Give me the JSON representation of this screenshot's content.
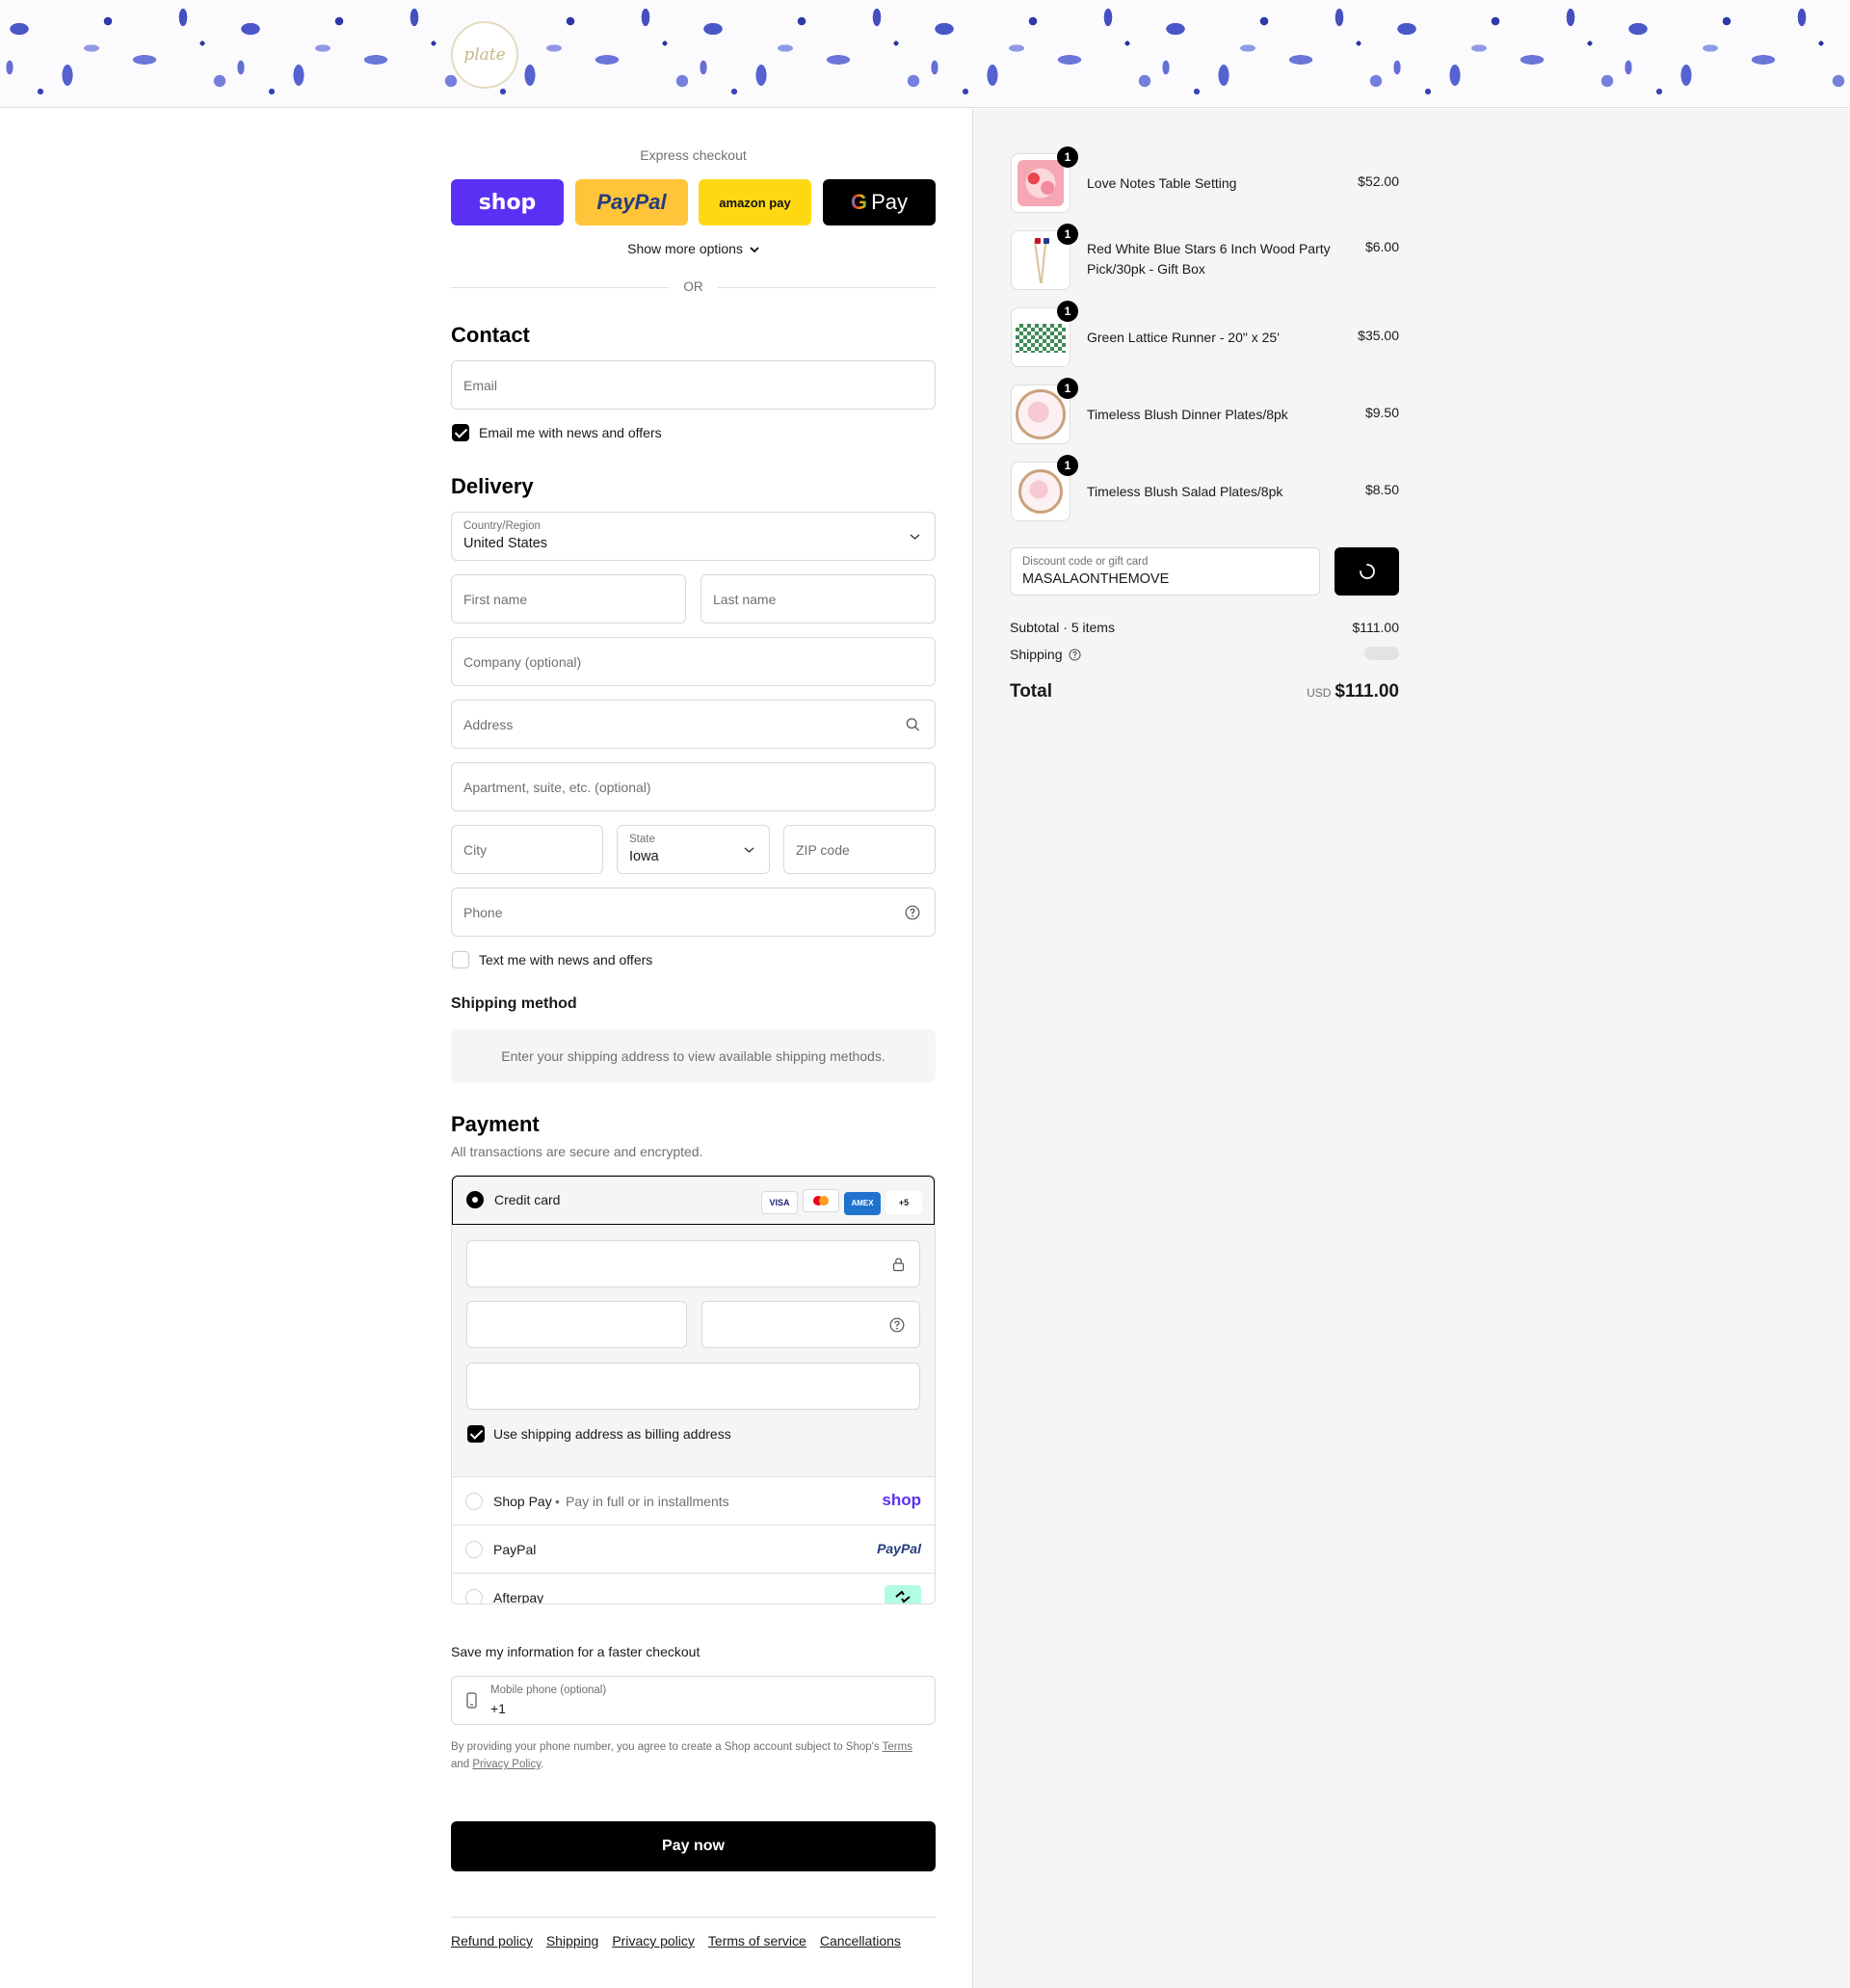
{
  "header": {
    "logo_text": "plate"
  },
  "express": {
    "title": "Express checkout",
    "buttons": [
      "shop",
      "PayPal",
      "amazon pay",
      "Pay"
    ],
    "colors": {
      "shop": "#5a31f4",
      "paypal": "#ffc439",
      "amazon": "#ffd814",
      "gpay": "#000000"
    },
    "more": "Show more options",
    "or": "OR"
  },
  "contact": {
    "heading": "Contact",
    "email_placeholder": "Email",
    "news_label": "Email me with news and offers",
    "news_checked": true
  },
  "delivery": {
    "heading": "Delivery",
    "country_label": "Country/Region",
    "country_value": "United States",
    "first_name": "First name",
    "last_name": "Last name",
    "company": "Company (optional)",
    "address": "Address",
    "apartment": "Apartment, suite, etc. (optional)",
    "city": "City",
    "state_label": "State",
    "state_value": "Iowa",
    "zip": "ZIP code",
    "phone": "Phone",
    "text_label": "Text me with news and offers",
    "text_checked": false
  },
  "shipping_method": {
    "heading": "Shipping method",
    "message": "Enter your shipping address to view available shipping methods."
  },
  "payment": {
    "heading": "Payment",
    "subtitle": "All transactions are secure and encrypted.",
    "credit_card": "Credit card",
    "card_brands": [
      "VISA",
      "MC",
      "AMEX",
      "+5"
    ],
    "billing_label": "Use shipping address as billing address",
    "billing_checked": true,
    "shop_pay": "Shop Pay",
    "shop_pay_sub": "Pay in full or in installments",
    "shop_logo": "shop",
    "paypal": "PayPal",
    "paypal_logo": "PayPal",
    "afterpay": "Afterpay"
  },
  "save": {
    "title": "Save my information for a faster checkout",
    "mobile_label": "Mobile phone (optional)",
    "mobile_value": "+1",
    "disclaimer_prefix": "By providing your phone number, you agree to create a Shop account subject to Shop's",
    "terms": "Terms",
    "and": "and",
    "privacy": "Privacy Policy"
  },
  "pay_button": "Pay now",
  "footer": [
    "Refund policy",
    "Shipping",
    "Privacy policy",
    "Terms of service",
    "Cancellations"
  ],
  "cart": {
    "items": [
      {
        "name": "Love Notes Table Setting",
        "price": "$52.00",
        "qty": "1"
      },
      {
        "name": "Red White Blue Stars 6 Inch Wood Party Pick/30pk - Gift Box",
        "price": "$6.00",
        "qty": "1"
      },
      {
        "name": "Green Lattice Runner - 20\" x 25'",
        "price": "$35.00",
        "qty": "1"
      },
      {
        "name": "Timeless Blush Dinner Plates/8pk",
        "price": "$9.50",
        "qty": "1"
      },
      {
        "name": "Timeless Blush Salad Plates/8pk",
        "price": "$8.50",
        "qty": "1"
      }
    ],
    "discount_label": "Discount code or gift card",
    "discount_value": "MASALAONTHEMOVE",
    "subtotal_label": "Subtotal · 5 items",
    "subtotal_value": "$111.00",
    "shipping_label": "Shipping",
    "total_label": "Total",
    "currency": "USD",
    "total_value": "$111.00"
  }
}
